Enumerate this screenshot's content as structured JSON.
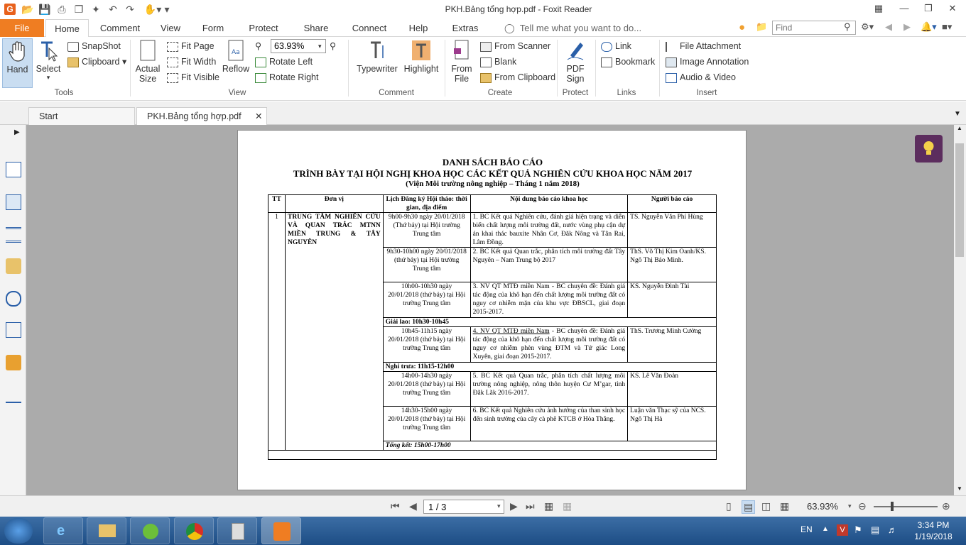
{
  "window": {
    "title": "PKH.Bảng tổng hợp.pdf - Foxit Reader"
  },
  "menu": {
    "file": "File",
    "tabs": [
      "Home",
      "Comment",
      "View",
      "Form",
      "Protect",
      "Share",
      "Connect",
      "Help",
      "Extras"
    ],
    "tell_me": "Tell me what you want to do...",
    "find_placeholder": "Find"
  },
  "ribbon": {
    "tools": {
      "hand": "Hand",
      "select": "Select",
      "snapshot": "SnapShot",
      "clipboard": "Clipboard",
      "label": "Tools"
    },
    "view": {
      "actual_size_1": "Actual",
      "actual_size_2": "Size",
      "fit_page": "Fit Page",
      "fit_width": "Fit Width",
      "fit_visible": "Fit Visible",
      "reflow": "Reflow",
      "zoom_value": "63.93%",
      "rotate_left": "Rotate Left",
      "rotate_right": "Rotate Right",
      "label": "View"
    },
    "comment": {
      "typewriter": "Typewriter",
      "highlight": "Highlight",
      "label": "Comment"
    },
    "create": {
      "from_file_1": "From",
      "from_file_2": "File",
      "from_scanner": "From Scanner",
      "blank": "Blank",
      "from_clipboard": "From Clipboard",
      "label": "Create"
    },
    "protect": {
      "pdf_sign_1": "PDF",
      "pdf_sign_2": "Sign",
      "label": "Protect"
    },
    "links": {
      "link": "Link",
      "bookmark": "Bookmark",
      "label": "Links"
    },
    "insert": {
      "file_attachment": "File Attachment",
      "image_annotation": "Image Annotation",
      "audio_video": "Audio & Video",
      "label": "Insert"
    }
  },
  "doc_tabs": {
    "start": "Start",
    "current": "PKH.Bảng tổng hợp.pdf"
  },
  "document": {
    "title1": "DANH SÁCH BÁO CÁO",
    "title2": "TRÌNH BÀY TẠI HỘI NGHỊ KHOA HỌC CÁC KẾT QUẢ NGHIÊN CỨU KHOA HỌC NĂM 2017",
    "title3": "(Viện Môi trường nông nghiệp – Tháng 1 năm 2018)",
    "headers": [
      "TT",
      "Đơn vị",
      "Lịch Đăng ký Hội thảo: thời gian, địa điểm",
      "Nội dung báo cáo khoa học",
      "Người báo cáo"
    ],
    "tt": "1",
    "unit": "TRUNG TÂM NGHIÊN CỨU VÀ QUAN TRẮC MTNN MIỀN TRUNG & TÂY NGUYÊN",
    "rows": [
      {
        "time": "9h00-9h30 ngày 20/01/2018 (Thứ bảy) tại Hội trường Trung tâm",
        "content": "1. BC Kết quả Nghiên cứu, đánh giá hiện trạng và diễn biến chất lượng môi trường đất, nước vùng phụ cận dự án khai thác bauxite Nhân Cơ, Đăk Nông và Tân Rai, Lâm Đồng.",
        "presenter": "TS. Nguyễn Văn Phí Hùng"
      },
      {
        "time": "9h30-10h00 ngày 20/01/2018 (thứ bảy) tại Hội trường Trung tâm",
        "content": "2. BC Kết quả Quan trắc, phân tích môi trường đất Tây Nguyên – Nam Trung bộ 2017",
        "presenter": "ThS. Võ Thị Kim Oanh/KS. Ngô Thị Bảo Minh."
      },
      {
        "time": "10h00-10h30 ngày 20/01/2018 (thứ bảy) tại Hội trường Trung tâm",
        "content": "3. NV QT MTĐ miền Nam - BC chuyên đề: Đánh giá tác động của khô hạn đến chất lượng môi trường đất có nguy cơ nhiễm mặn của khu vực ĐBSCL, giai đoạn 2015-2017.",
        "presenter": "KS. Nguyễn Đình Tài"
      },
      {
        "time": "10h45-11h15 ngày 20/01/2018 (thứ bảy) tại Hội trường Trung tâm",
        "content_prefix": "4. NV QT MTĐ miền Nam",
        "content": " - BC chuyên đề: Đánh giá tác động của khô hạn đến chất lượng môi trường đất có nguy cơ nhiễm phèn vùng ĐTM và Tứ giác Long Xuyên, giai đoạn 2015-2017.",
        "presenter": "ThS. Trương Minh Cường"
      },
      {
        "time": "14h00-14h30 ngày 20/01/2018 (thứ bảy) tại Hội trường Trung tâm",
        "content": "5. BC Kết quả Quan trắc, phân tích chất lượng môi trường nông nghiệp, nông thôn huyện Cư M’gar, tỉnh Đăk Lăk 2016-2017.",
        "presenter": "KS. Lê Văn Đoàn"
      },
      {
        "time": "14h30-15h00 ngày 20/01/2018 (thứ bảy) tại Hội trường Trung tâm",
        "content": "6. BC Kết quả Nghiên cứu ảnh hưởng của than sinh học đến sinh trưởng của cây cà phê KTCB ở Hòa Thắng.",
        "presenter": "Luận văn Thạc sỹ của NCS. Ngô Thị Hà"
      }
    ],
    "break1": "Giải lao: 10h30-10h45",
    "break2": "Nghỉ trưa: 11h15-12h00",
    "summary": "Tổng kết:  15h00-17h00"
  },
  "status": {
    "page": "1 / 3",
    "zoom": "63.93%"
  },
  "tray": {
    "lang": "EN",
    "time": "3:34 PM",
    "date": "1/19/2018"
  }
}
